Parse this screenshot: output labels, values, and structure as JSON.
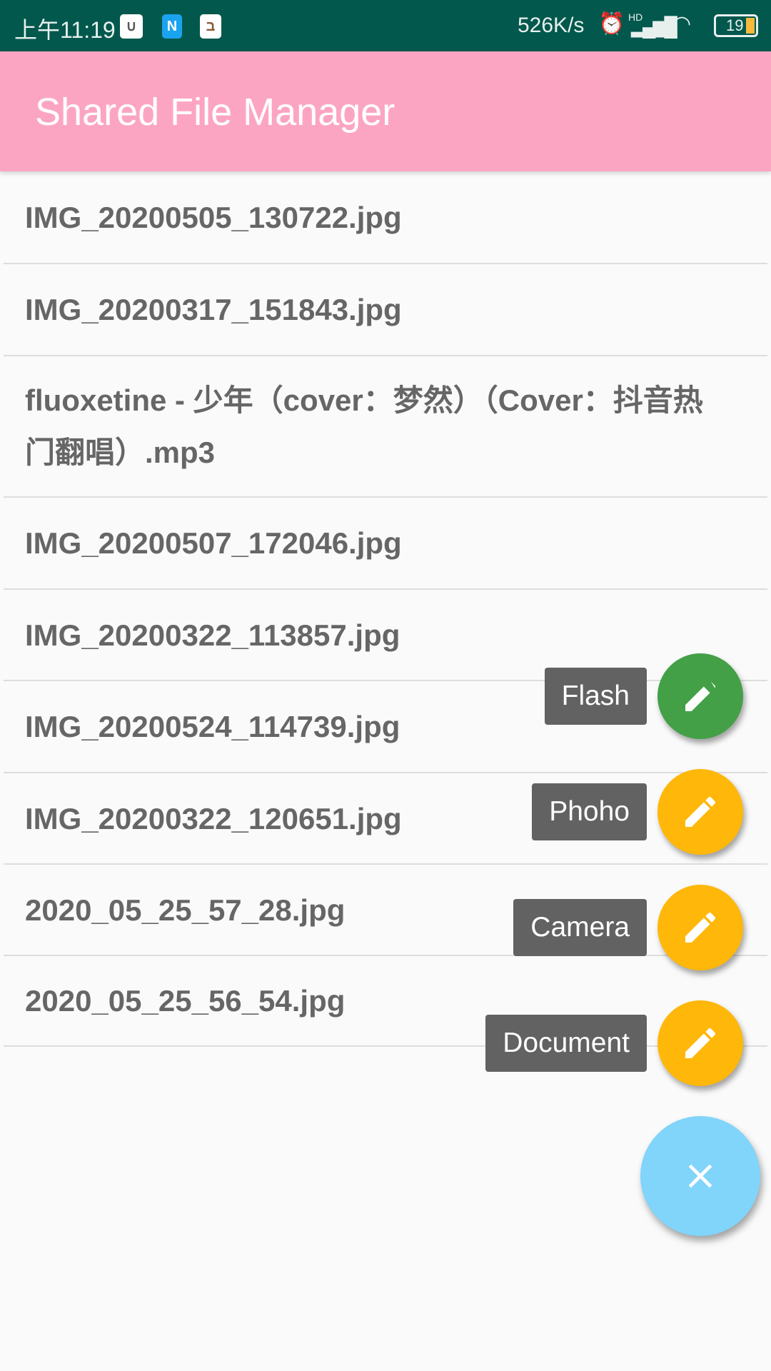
{
  "status_bar": {
    "time": "上午11:19",
    "speed": "526K/s",
    "battery": "19",
    "hd": "HD"
  },
  "app_bar": {
    "title": "Shared File Manager"
  },
  "files": [
    "IMG_20200505_130722.jpg",
    "IMG_20200317_151843.jpg",
    "fluoxetine - 少年（cover：梦然）（Cover：抖音热门翻唱）.mp3",
    "IMG_20200507_172046.jpg",
    "IMG_20200322_113857.jpg",
    "IMG_20200524_114739.jpg",
    "IMG_20200322_120651.jpg",
    "2020_05_25_57_28.jpg",
    "2020_05_25_56_54.jpg"
  ],
  "fab_menu": [
    {
      "label": "Flash",
      "color": "#43a047"
    },
    {
      "label": "Phoho",
      "color": "#ffb70a"
    },
    {
      "label": "Camera",
      "color": "#ffb70a"
    },
    {
      "label": "Document",
      "color": "#ffb70a"
    }
  ],
  "main_fab": {
    "icon": "close-icon",
    "color": "#81d4fa"
  }
}
